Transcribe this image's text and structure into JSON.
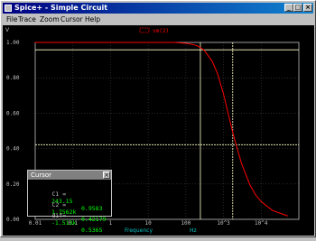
{
  "window": {
    "title": "Spice+ - Simple Circuit",
    "minimize_glyph": "_",
    "maximize_glyph": "□",
    "close_glyph": "×"
  },
  "menu": [
    "File",
    "Trace",
    "Zoom",
    "Cursor",
    "Help"
  ],
  "plot": {
    "y_unit": "V",
    "x_label": "Frequency",
    "x_unit": "Hz",
    "legend": "vm(2)",
    "trace_color": "#ff0000",
    "cursor_line_color": "#ffffcc"
  },
  "chart_data": {
    "type": "line",
    "x_scale": "log",
    "xlim": [
      0.01,
      100000
    ],
    "ylim": [
      0.0,
      1.0
    ],
    "ylabel": "V",
    "xlabel": "Frequency",
    "x_ticks": [
      "0.01",
      "0.1",
      "1",
      "10",
      "100",
      "10^3",
      "10^4"
    ],
    "y_ticks": [
      "0.00",
      "0.20",
      "0.40",
      "0.60",
      "0.80",
      "1.00"
    ],
    "y_tick_values": [
      0.0,
      0.2,
      0.4,
      0.6,
      0.8,
      1.0
    ],
    "x_tick_values": [
      0.01,
      0.1,
      1,
      10,
      100,
      1000,
      10000
    ],
    "grid": true,
    "series": [
      {
        "name": "vm(2)",
        "x": [
          0.01,
          0.1,
          1,
          10,
          50,
          100,
          150,
          200,
          300,
          500,
          700,
          1000,
          1500,
          2000,
          3000,
          5000,
          7000,
          10000,
          20000,
          50000
        ],
        "y": [
          1.0,
          1.0,
          1.0,
          1.0,
          1.0,
          0.995,
          0.989,
          0.981,
          0.958,
          0.894,
          0.821,
          0.707,
          0.551,
          0.447,
          0.316,
          0.196,
          0.141,
          0.1,
          0.05,
          0.02
        ]
      }
    ],
    "cursors": {
      "c1": {
        "x": 243.15,
        "y": 0.9583
      },
      "c2": {
        "x": 1756.2,
        "y": 0.42179
      }
    }
  },
  "cursor_panel": {
    "title": "Cursor",
    "close_glyph": "×",
    "rows": [
      {
        "label": "C1 =",
        "x": "243.15",
        "y": "0.9583"
      },
      {
        "label": "C2 =",
        "x": "1.7562k",
        "y": "0.42179"
      },
      {
        "label": "dif=",
        "x": "-1.513k",
        "y": "0.5365"
      }
    ]
  }
}
